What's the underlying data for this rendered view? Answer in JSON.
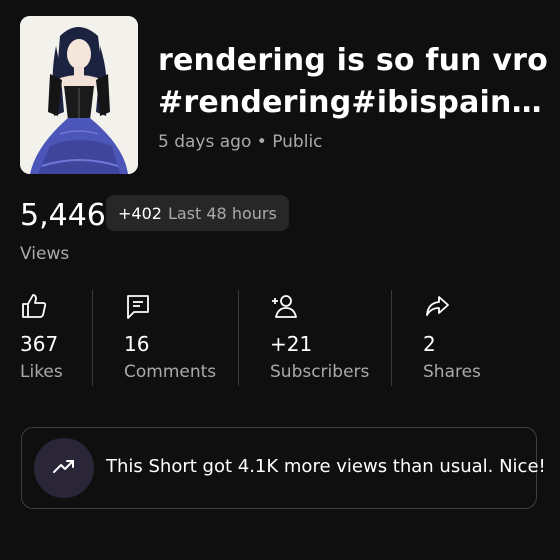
{
  "video": {
    "title_line1": "rendering is so fun vro",
    "title_line2": "#rendering#ibispaint...",
    "age": "5 days ago",
    "separator": "•",
    "visibility": "Public"
  },
  "views": {
    "count": "5,446",
    "delta": "+402",
    "period": "Last 48 hours",
    "label": "Views"
  },
  "stats": [
    {
      "icon": "thumbs-up-icon",
      "value": "367",
      "label": "Likes"
    },
    {
      "icon": "comment-icon",
      "value": "16",
      "label": "Comments"
    },
    {
      "icon": "add-person-icon",
      "value": "+21",
      "label": "Subscribers"
    },
    {
      "icon": "share-icon",
      "value": "2",
      "label": "Shares"
    }
  ],
  "insight": {
    "icon": "trending-up-icon",
    "message": "This Short got 4.1K more views than usual. Nice!",
    "accent": "#2a2537"
  }
}
